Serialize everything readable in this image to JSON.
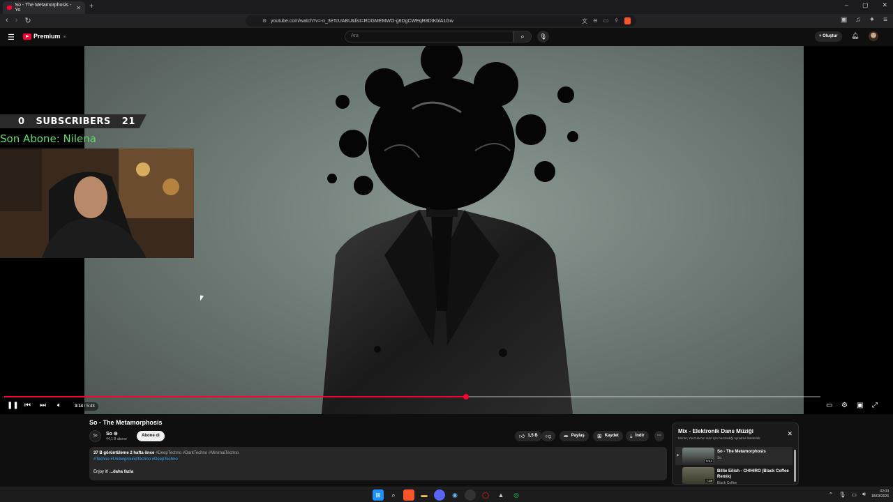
{
  "browser": {
    "tab_title": "So - The Metamorphosis - Yo",
    "new_tab": "+",
    "url": "youtube.com/watch?v=-n_3eTcUABU&list=RDGMEMWO-g6DgCWEqR8DtKblA1Gw",
    "window_controls": [
      "–",
      "▢",
      "✕"
    ]
  },
  "youtube_header": {
    "logo_text": "Premium",
    "logo_sup": "TR",
    "search_placeholder": "Ara",
    "create_label": "Oluştur"
  },
  "overlay": {
    "subs_left": "0",
    "subs_label": "SUBSCRIBERS",
    "subs_right": "21",
    "last_sub": "Son Abone: Nilena"
  },
  "player": {
    "time_current": "3:14",
    "time_total": "5:43",
    "progress_fraction": 0.566
  },
  "video": {
    "title": "So - The Metamorphosis",
    "channel": "So ⊚",
    "subscribers": "44,1 B abone",
    "subscribe_label": "Abone ol",
    "likes": "1,5 B",
    "share_label": "Paylaş",
    "save_label": "Kaydet",
    "download_label": "İndir",
    "more": "···"
  },
  "description": {
    "views": "37 B görüntüleme",
    "ago": "2 hafta önce",
    "tags_line1": "#DeepTechno #DarkTechno #MinimalTechno",
    "tags_line2": "#Techno #UndergroundTechno #DeepTechno",
    "body": "Enjoy it!",
    "more_label": "...daha fazla"
  },
  "mix": {
    "title": "Mix - Elektronik Dans Müziği",
    "subtitle": "Mix'ler, YouTube'un sizin için hazırladığı oynatma listeleridir",
    "items": [
      {
        "name": "So - The Metamorphosis",
        "channel": "So",
        "duration": "5:44"
      },
      {
        "name": "Billie Eilish - CHIHIRO (Black Coffee Remix)",
        "channel": "Black Coffee",
        "duration": "7:39"
      }
    ]
  },
  "taskbar": {
    "time": "02:00",
    "date": "18/03/2026"
  }
}
